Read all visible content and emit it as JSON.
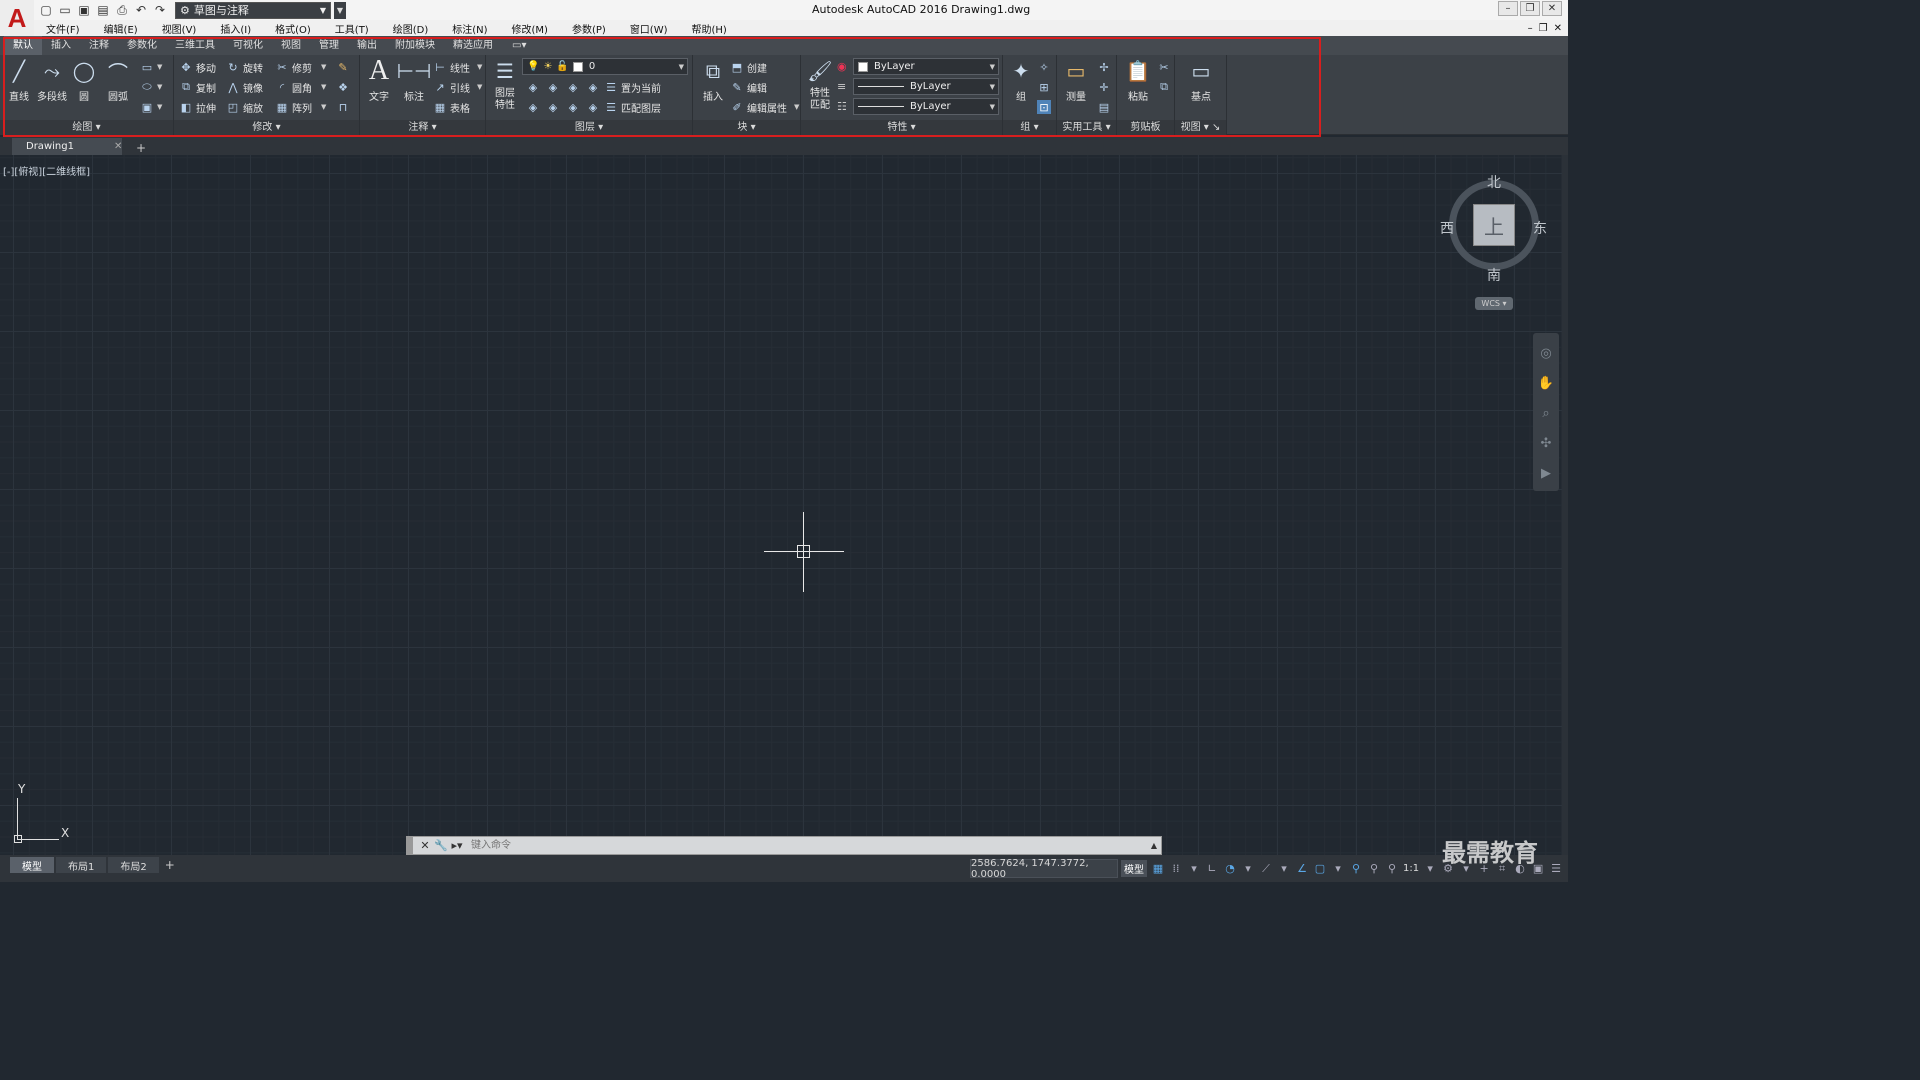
{
  "window": {
    "title": "Autodesk AutoCAD 2016    Drawing1.dwg",
    "workspace": "草图与注释",
    "logo_letter": "A"
  },
  "menu": [
    "文件(F)",
    "编辑(E)",
    "视图(V)",
    "插入(I)",
    "格式(O)",
    "工具(T)",
    "绘图(D)",
    "标注(N)",
    "修改(M)",
    "参数(P)",
    "窗口(W)",
    "帮助(H)"
  ],
  "ribbon_tabs": [
    "默认",
    "插入",
    "注释",
    "参数化",
    "三维工具",
    "可视化",
    "视图",
    "管理",
    "输出",
    "附加模块",
    "精选应用"
  ],
  "panels": {
    "draw": {
      "title": "绘图",
      "line": "直线",
      "polyline": "多段线",
      "circle": "圆",
      "arc": "圆弧"
    },
    "modify": {
      "title": "修改",
      "move": "移动",
      "rotate": "旋转",
      "trim": "修剪",
      "copy": "复制",
      "mirror": "镜像",
      "fillet": "圆角",
      "stretch": "拉伸",
      "scale": "缩放",
      "array": "阵列"
    },
    "annotation": {
      "title": "注释",
      "text": "文字",
      "dimension": "标注",
      "linear": "线性",
      "leader": "引线",
      "table": "表格"
    },
    "layers": {
      "title": "图层",
      "layer_props": "图层\n特性",
      "current_layer": "0",
      "set_current": "置为当前",
      "match_layer": "匹配图层"
    },
    "block": {
      "title": "块",
      "insert": "插入",
      "create": "创建",
      "edit": "编辑",
      "edit_attr": "编辑属性"
    },
    "properties": {
      "title": "特性",
      "match_props": "特性\n匹配",
      "color": "ByLayer",
      "linetype": "ByLayer",
      "lineweight": "ByLayer"
    },
    "groups": {
      "title": "组",
      "group": "组"
    },
    "utilities": {
      "title": "实用工具",
      "measure": "测量"
    },
    "clipboard": {
      "title": "剪贴板",
      "paste": "粘贴"
    },
    "view": {
      "title": "视图",
      "base": "基点"
    }
  },
  "file_tab": {
    "name": "Drawing1"
  },
  "viewport_label": "[-][俯视][二维线框]",
  "viewcube": {
    "top": "上",
    "north": "北",
    "south": "南",
    "east": "东",
    "west": "西",
    "wcs": "WCS"
  },
  "ucs": {
    "x": "X",
    "y": "Y"
  },
  "command": {
    "placeholder": "键入命令"
  },
  "layout_tabs": [
    "模型",
    "布局1",
    "布局2"
  ],
  "status": {
    "coords": "2586.7624, 1747.3772, 0.0000",
    "model": "模型",
    "scale": "1:1"
  },
  "watermark": "最需教育"
}
